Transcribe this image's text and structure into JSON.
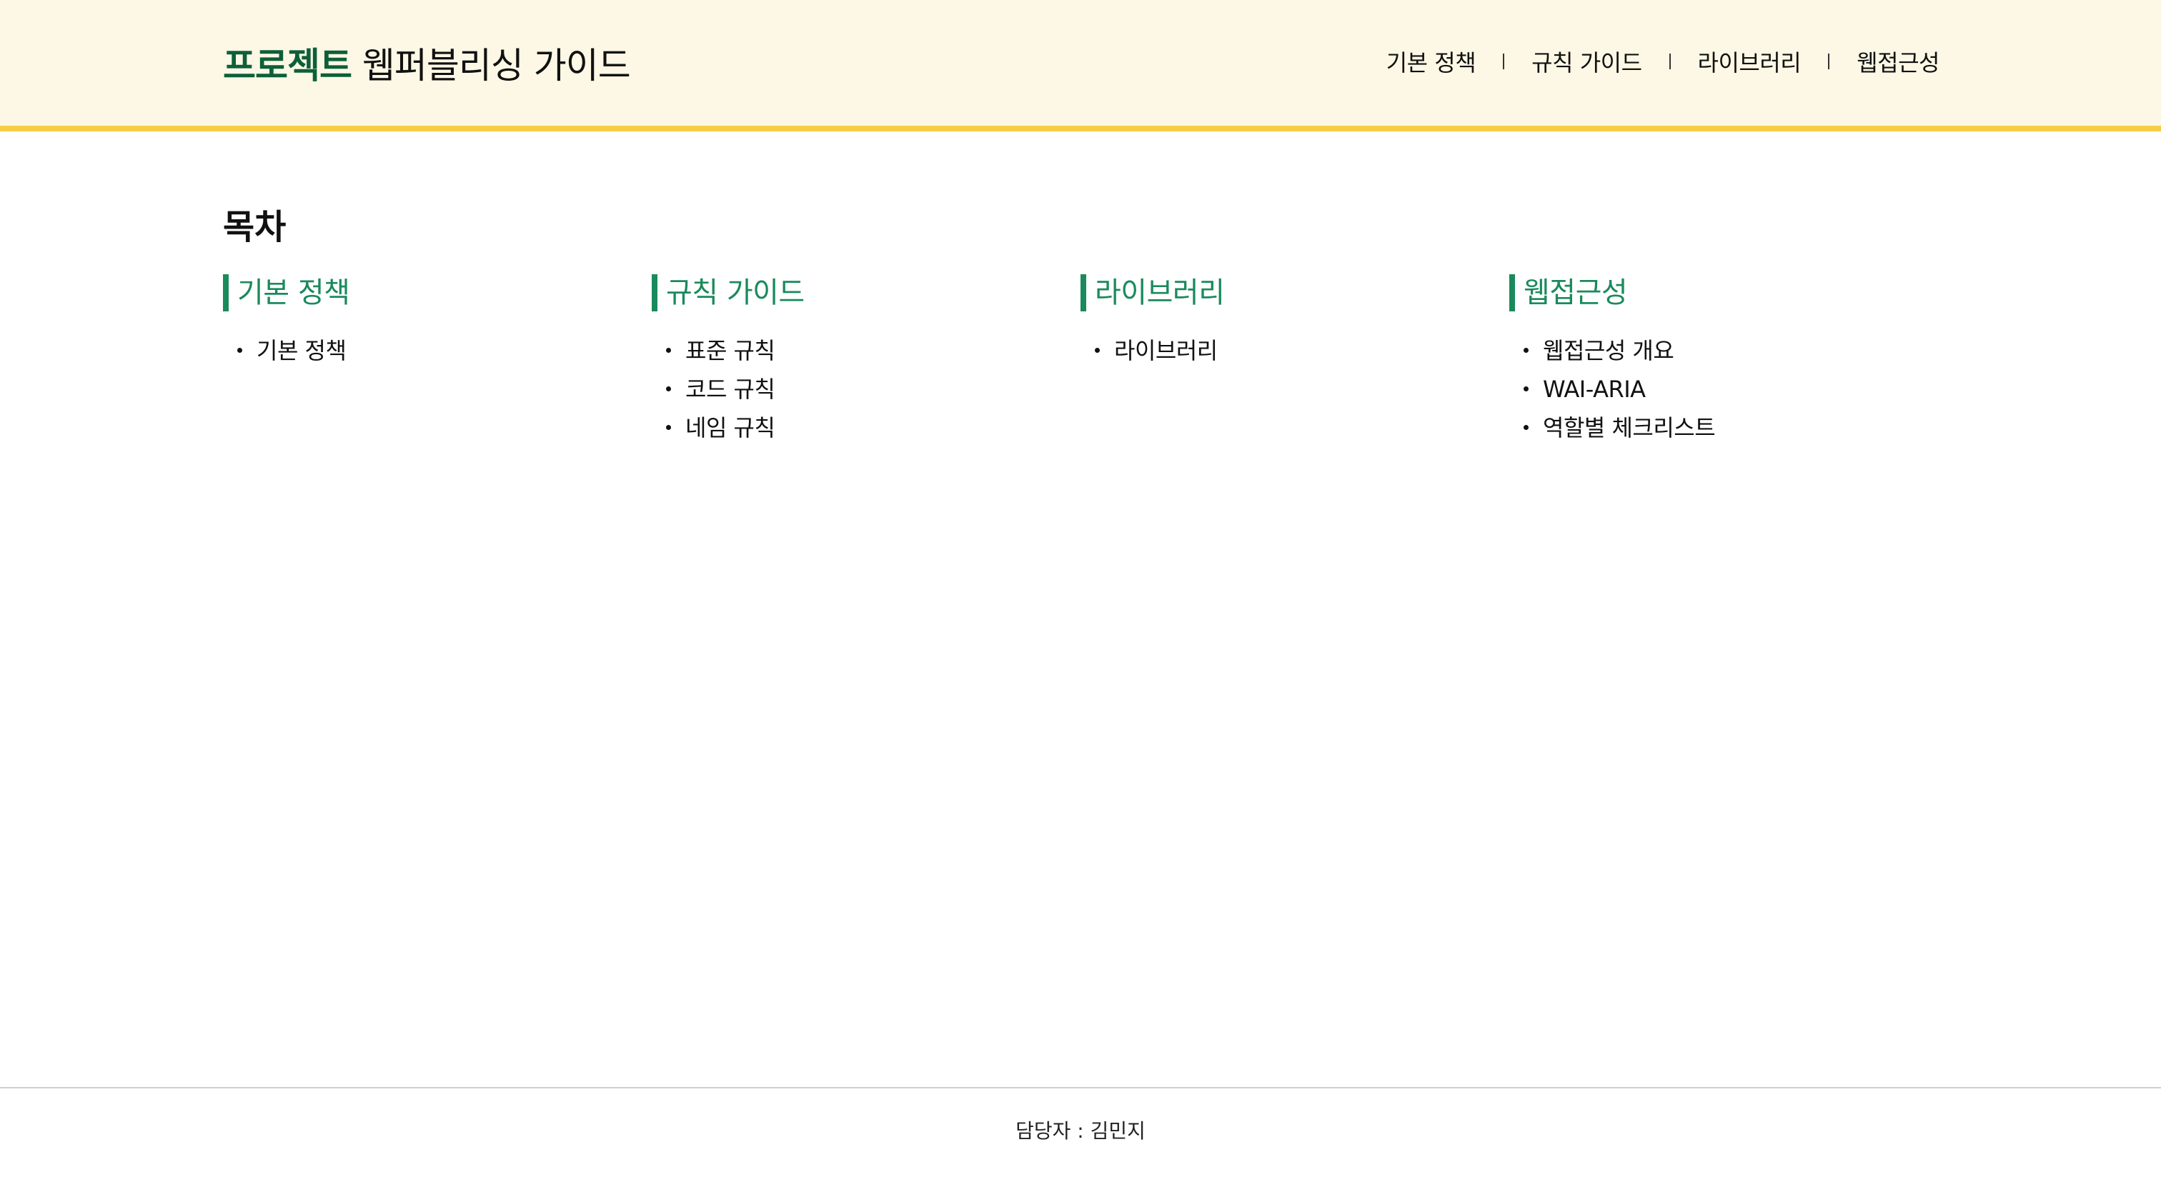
{
  "header": {
    "logo_strong": "프로젝트",
    "logo_rest": "웹퍼블리싱 가이드",
    "nav": [
      {
        "label": "기본 정책"
      },
      {
        "label": "규칙 가이드"
      },
      {
        "label": "라이브러리"
      },
      {
        "label": "웹접근성"
      }
    ]
  },
  "main": {
    "title": "목차",
    "sections": [
      {
        "heading": "기본 정책",
        "items": [
          "기본 정책"
        ]
      },
      {
        "heading": "규칙 가이드",
        "items": [
          "표준 규칙",
          "코드 규칙",
          "네임 규칙"
        ]
      },
      {
        "heading": "라이브러리",
        "items": [
          "라이브러리"
        ]
      },
      {
        "heading": "웹접근성",
        "items": [
          "웹접근성 개요",
          "WAI-ARIA",
          "역할별 체크리스트"
        ]
      }
    ]
  },
  "footer": {
    "text": "담당자 : 김민지"
  },
  "colors": {
    "header_bg": "#fdf8e5",
    "header_border": "#f5cd47",
    "logo_green": "#0d5f3a",
    "accent_green": "#1a8a5c"
  }
}
